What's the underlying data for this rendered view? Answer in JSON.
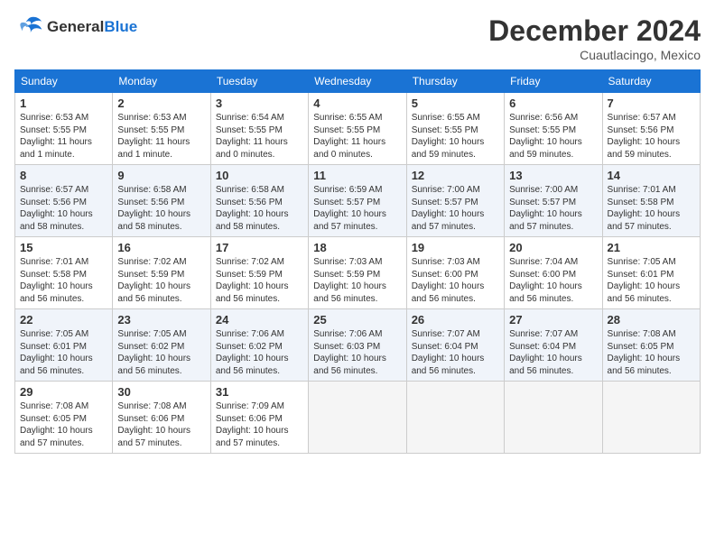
{
  "header": {
    "logo_line1": "General",
    "logo_line2": "Blue",
    "month": "December 2024",
    "location": "Cuautlacingo, Mexico"
  },
  "weekdays": [
    "Sunday",
    "Monday",
    "Tuesday",
    "Wednesday",
    "Thursday",
    "Friday",
    "Saturday"
  ],
  "weeks": [
    [
      {
        "day": "1",
        "sunrise": "6:53 AM",
        "sunset": "5:55 PM",
        "daylight": "11 hours and 1 minute."
      },
      {
        "day": "2",
        "sunrise": "6:53 AM",
        "sunset": "5:55 PM",
        "daylight": "11 hours and 1 minute."
      },
      {
        "day": "3",
        "sunrise": "6:54 AM",
        "sunset": "5:55 PM",
        "daylight": "11 hours and 0 minutes."
      },
      {
        "day": "4",
        "sunrise": "6:55 AM",
        "sunset": "5:55 PM",
        "daylight": "11 hours and 0 minutes."
      },
      {
        "day": "5",
        "sunrise": "6:55 AM",
        "sunset": "5:55 PM",
        "daylight": "10 hours and 59 minutes."
      },
      {
        "day": "6",
        "sunrise": "6:56 AM",
        "sunset": "5:55 PM",
        "daylight": "10 hours and 59 minutes."
      },
      {
        "day": "7",
        "sunrise": "6:57 AM",
        "sunset": "5:56 PM",
        "daylight": "10 hours and 59 minutes."
      }
    ],
    [
      {
        "day": "8",
        "sunrise": "6:57 AM",
        "sunset": "5:56 PM",
        "daylight": "10 hours and 58 minutes."
      },
      {
        "day": "9",
        "sunrise": "6:58 AM",
        "sunset": "5:56 PM",
        "daylight": "10 hours and 58 minutes."
      },
      {
        "day": "10",
        "sunrise": "6:58 AM",
        "sunset": "5:56 PM",
        "daylight": "10 hours and 58 minutes."
      },
      {
        "day": "11",
        "sunrise": "6:59 AM",
        "sunset": "5:57 PM",
        "daylight": "10 hours and 57 minutes."
      },
      {
        "day": "12",
        "sunrise": "7:00 AM",
        "sunset": "5:57 PM",
        "daylight": "10 hours and 57 minutes."
      },
      {
        "day": "13",
        "sunrise": "7:00 AM",
        "sunset": "5:57 PM",
        "daylight": "10 hours and 57 minutes."
      },
      {
        "day": "14",
        "sunrise": "7:01 AM",
        "sunset": "5:58 PM",
        "daylight": "10 hours and 57 minutes."
      }
    ],
    [
      {
        "day": "15",
        "sunrise": "7:01 AM",
        "sunset": "5:58 PM",
        "daylight": "10 hours and 56 minutes."
      },
      {
        "day": "16",
        "sunrise": "7:02 AM",
        "sunset": "5:59 PM",
        "daylight": "10 hours and 56 minutes."
      },
      {
        "day": "17",
        "sunrise": "7:02 AM",
        "sunset": "5:59 PM",
        "daylight": "10 hours and 56 minutes."
      },
      {
        "day": "18",
        "sunrise": "7:03 AM",
        "sunset": "5:59 PM",
        "daylight": "10 hours and 56 minutes."
      },
      {
        "day": "19",
        "sunrise": "7:03 AM",
        "sunset": "6:00 PM",
        "daylight": "10 hours and 56 minutes."
      },
      {
        "day": "20",
        "sunrise": "7:04 AM",
        "sunset": "6:00 PM",
        "daylight": "10 hours and 56 minutes."
      },
      {
        "day": "21",
        "sunrise": "7:05 AM",
        "sunset": "6:01 PM",
        "daylight": "10 hours and 56 minutes."
      }
    ],
    [
      {
        "day": "22",
        "sunrise": "7:05 AM",
        "sunset": "6:01 PM",
        "daylight": "10 hours and 56 minutes."
      },
      {
        "day": "23",
        "sunrise": "7:05 AM",
        "sunset": "6:02 PM",
        "daylight": "10 hours and 56 minutes."
      },
      {
        "day": "24",
        "sunrise": "7:06 AM",
        "sunset": "6:02 PM",
        "daylight": "10 hours and 56 minutes."
      },
      {
        "day": "25",
        "sunrise": "7:06 AM",
        "sunset": "6:03 PM",
        "daylight": "10 hours and 56 minutes."
      },
      {
        "day": "26",
        "sunrise": "7:07 AM",
        "sunset": "6:04 PM",
        "daylight": "10 hours and 56 minutes."
      },
      {
        "day": "27",
        "sunrise": "7:07 AM",
        "sunset": "6:04 PM",
        "daylight": "10 hours and 56 minutes."
      },
      {
        "day": "28",
        "sunrise": "7:08 AM",
        "sunset": "6:05 PM",
        "daylight": "10 hours and 56 minutes."
      }
    ],
    [
      {
        "day": "29",
        "sunrise": "7:08 AM",
        "sunset": "6:05 PM",
        "daylight": "10 hours and 57 minutes."
      },
      {
        "day": "30",
        "sunrise": "7:08 AM",
        "sunset": "6:06 PM",
        "daylight": "10 hours and 57 minutes."
      },
      {
        "day": "31",
        "sunrise": "7:09 AM",
        "sunset": "6:06 PM",
        "daylight": "10 hours and 57 minutes."
      },
      null,
      null,
      null,
      null
    ]
  ]
}
